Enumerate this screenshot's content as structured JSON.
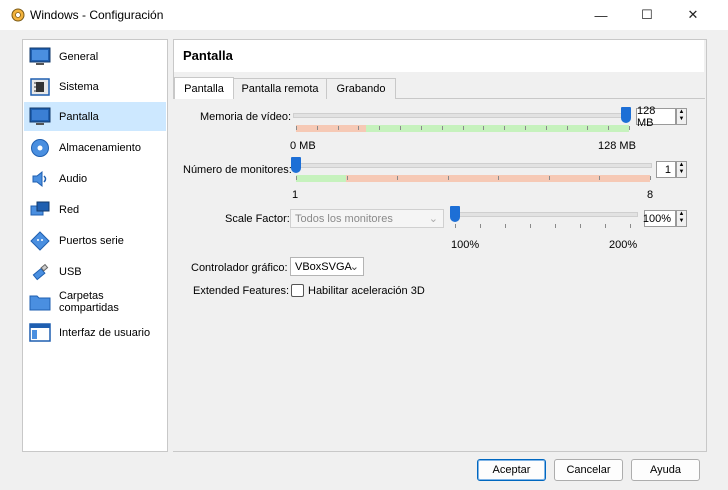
{
  "window": {
    "title": "Windows - Configuración",
    "minimize": "—",
    "maximize": "☐",
    "close": "✕"
  },
  "sidebar": {
    "items": [
      {
        "label": "General",
        "icon": "monitor-icon"
      },
      {
        "label": "Sistema",
        "icon": "chip-icon"
      },
      {
        "label": "Pantalla",
        "icon": "display-icon",
        "selected": true
      },
      {
        "label": "Almacenamiento",
        "icon": "disk-icon"
      },
      {
        "label": "Audio",
        "icon": "speaker-icon"
      },
      {
        "label": "Red",
        "icon": "network-icon"
      },
      {
        "label": "Puertos serie",
        "icon": "serial-port-icon"
      },
      {
        "label": "USB",
        "icon": "usb-icon"
      },
      {
        "label": "Carpetas compartidas",
        "icon": "folder-icon"
      },
      {
        "label": "Interfaz de usuario",
        "icon": "ui-window-icon"
      }
    ]
  },
  "content": {
    "title": "Pantalla"
  },
  "tabs": [
    {
      "label": "Pantalla",
      "active": true
    },
    {
      "label": "Pantalla remota"
    },
    {
      "label": "Grabando"
    }
  ],
  "screen": {
    "video_memory": {
      "label": "Memoria de vídeo:",
      "value": "128 MB",
      "min_label": "0 MB",
      "max_label": "128 MB",
      "level": 1.0
    },
    "monitors": {
      "label": "Número de monitores:",
      "value": "1",
      "min_label": "1",
      "max_label": "8",
      "level": 0.0
    },
    "scale": {
      "label": "Scale Factor:",
      "combo": "Todos los monitores",
      "value": "100%",
      "min_label": "100%",
      "max_label": "200%",
      "level": 0.0
    },
    "controller": {
      "label": "Controlador gráfico:",
      "value": "VBoxSVGA"
    },
    "extended": {
      "label": "Extended Features:",
      "checkbox_label": "Habilitar aceleración 3D",
      "checked": false
    }
  },
  "buttons": {
    "ok": "Aceptar",
    "cancel": "Cancelar",
    "help": "Ayuda"
  },
  "colors": {
    "accent": "#1d6fd6",
    "selection": "#cde8ff",
    "good_bar": "#c6f2bd",
    "bad_bar": "#f6c9b5"
  }
}
